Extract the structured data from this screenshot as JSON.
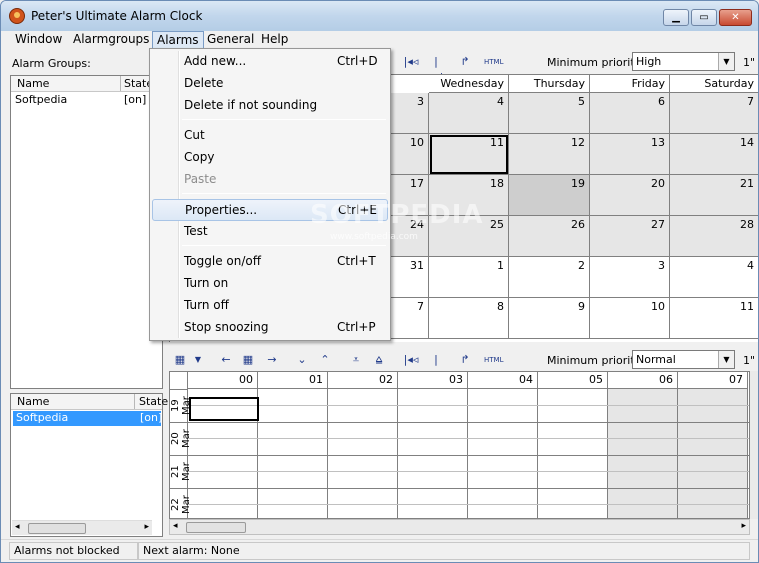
{
  "window": {
    "title": "Peter's Ultimate Alarm Clock",
    "min_glyph": "▁",
    "max_glyph": "▭",
    "close_glyph": "✕"
  },
  "menubar": [
    "Window",
    "Alarmgroups",
    "Alarms",
    "General",
    "Help"
  ],
  "left": {
    "groups_label": "Alarm Groups:",
    "columns": [
      "Name",
      "State"
    ],
    "groups": [
      {
        "name": "Softpedia",
        "state": "[on]"
      }
    ],
    "columns2": [
      "Name",
      "State"
    ],
    "alarms": [
      {
        "name": "Softpedia",
        "state": "[on]"
      }
    ],
    "scroll_left": "◂",
    "scroll_right": "▸"
  },
  "alarms_menu": [
    {
      "label": "Add new...",
      "shortcut": "Ctrl+D",
      "enabled": true
    },
    {
      "label": "Delete",
      "shortcut": "",
      "enabled": true
    },
    {
      "label": "Delete if not sounding",
      "shortcut": "",
      "enabled": true
    },
    {
      "label": "Cut",
      "shortcut": "",
      "enabled": true
    },
    {
      "label": "Copy",
      "shortcut": "",
      "enabled": true
    },
    {
      "label": "Paste",
      "shortcut": "",
      "enabled": false
    },
    {
      "label": "Properties...",
      "shortcut": "Ctrl+E",
      "enabled": true,
      "highlighted": true
    },
    {
      "label": "Test",
      "shortcut": "",
      "enabled": true
    },
    {
      "label": "Toggle on/off",
      "shortcut": "Ctrl+T",
      "enabled": true
    },
    {
      "label": "Turn on",
      "shortcut": "",
      "enabled": true
    },
    {
      "label": "Turn off",
      "shortcut": "",
      "enabled": true
    },
    {
      "label": "Stop snoozing",
      "shortcut": "Ctrl+P",
      "enabled": true
    }
  ],
  "toolbar_top": {
    "priority_label": "Minimum priority:",
    "priority_value": "High",
    "trailing": "1\""
  },
  "toolbar_bottom": {
    "priority_label": "Minimum priority:",
    "priority_value": "Normal",
    "trailing": "1\""
  },
  "calendar": {
    "headers": [
      "uesday",
      "Wednesday",
      "Thursday",
      "Friday",
      "Saturday"
    ],
    "weeks": [
      [
        "3",
        "4",
        "5",
        "6",
        "7"
      ],
      [
        "10",
        "11",
        "12",
        "13",
        "14"
      ],
      [
        "17",
        "18",
        "19",
        "20",
        "21"
      ],
      [
        "24",
        "25",
        "26",
        "27",
        "28"
      ],
      [
        "31",
        "1",
        "2",
        "3",
        "4"
      ],
      [
        "7",
        "8",
        "9",
        "10",
        "11"
      ]
    ]
  },
  "timeline": {
    "hours": [
      "00",
      "01",
      "02",
      "03",
      "04",
      "05",
      "06",
      "07"
    ],
    "dates": [
      "19 Mar",
      "20 Mar",
      "21 Mar",
      "22 Mar"
    ]
  },
  "status": {
    "left": "Alarms not blocked",
    "right": "Next alarm: None"
  },
  "watermark": {
    "brand": "SOFTPEDIA",
    "url": "www.softpedia.com"
  }
}
